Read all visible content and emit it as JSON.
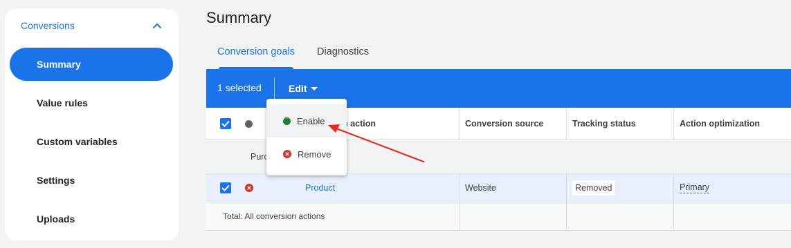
{
  "sidebar": {
    "header": "Conversions",
    "items": [
      {
        "label": "Summary",
        "active": true
      },
      {
        "label": "Value rules"
      },
      {
        "label": "Custom variables"
      },
      {
        "label": "Settings"
      },
      {
        "label": "Uploads"
      }
    ]
  },
  "page": {
    "title": "Summary",
    "tabs": [
      {
        "label": "Conversion goals",
        "active": true
      },
      {
        "label": "Diagnostics"
      }
    ]
  },
  "selection_bar": {
    "count_text": "1 selected",
    "edit_label": "Edit"
  },
  "table": {
    "columns": [
      "Conversion action",
      "Conversion source",
      "Tracking status",
      "Action optimization"
    ],
    "group_label": "Purchase",
    "row": {
      "action": "Product",
      "source": "Website",
      "status": "Removed",
      "optimization": "Primary"
    },
    "total_label": "Total: All conversion actions"
  },
  "edit_menu": {
    "items": [
      {
        "label": "Enable",
        "icon": "green-dot-icon"
      },
      {
        "label": "Remove",
        "icon": "red-x-icon"
      }
    ]
  },
  "colors": {
    "accent": "#1a73e8",
    "enabled": "#188038",
    "removed": "#d93025",
    "annotation_arrow": "#e8291c"
  }
}
